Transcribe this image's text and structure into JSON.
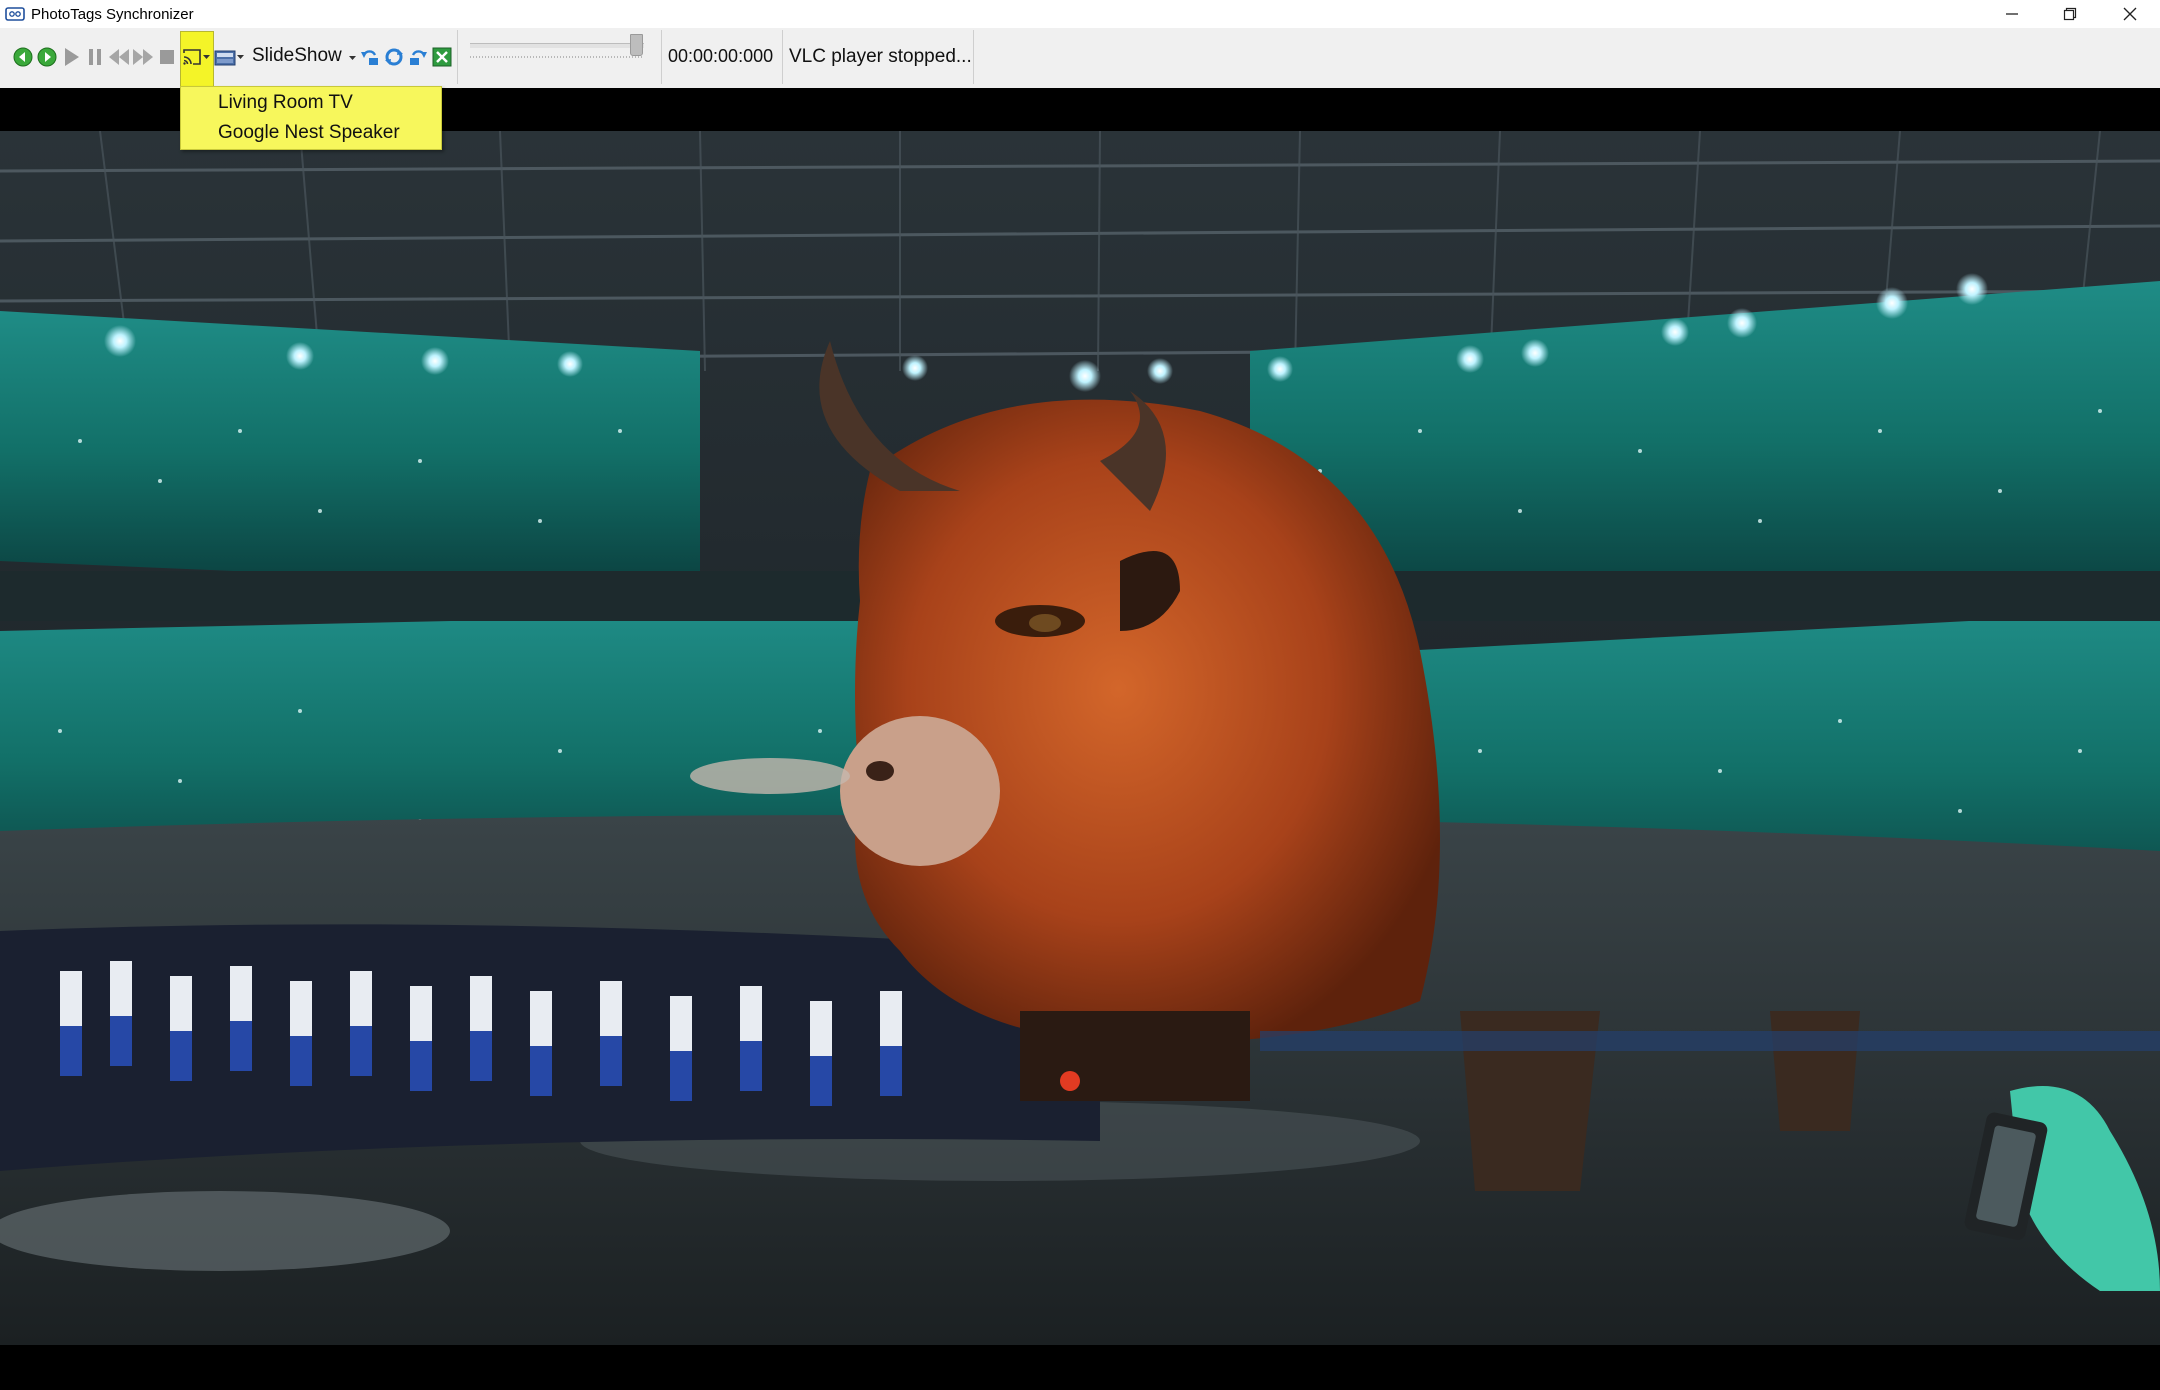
{
  "window": {
    "title": "PhotoTags Synchronizer",
    "controls": [
      "minimize",
      "restore",
      "close"
    ]
  },
  "toolbar": {
    "buttons": [
      {
        "icon": "previous-green-icon"
      },
      {
        "icon": "next-green-icon"
      },
      {
        "icon": "play-icon"
      },
      {
        "icon": "pause-icon"
      },
      {
        "icon": "rewind-icon"
      },
      {
        "icon": "fast-forward-icon"
      },
      {
        "icon": "stop-icon"
      },
      {
        "icon": "cast-icon"
      },
      {
        "icon": "slideshow-icon"
      },
      {
        "icon": "rotate-left-icon"
      },
      {
        "icon": "rotate-180-icon"
      },
      {
        "icon": "rotate-right-icon"
      },
      {
        "icon": "close-media-icon"
      }
    ],
    "slideshow_label": "SlideShow",
    "seek_position": 0.98,
    "timecode": "00:00:00:000",
    "status": "VLC player stopped..."
  },
  "cast_menu": {
    "items": [
      "Living Room TV",
      "Google Nest Speaker"
    ]
  },
  "colors": {
    "menu_bg": "#f7f75c",
    "cast_highlight": "#f4f428",
    "toolbar_bg": "#f0f0f0"
  }
}
